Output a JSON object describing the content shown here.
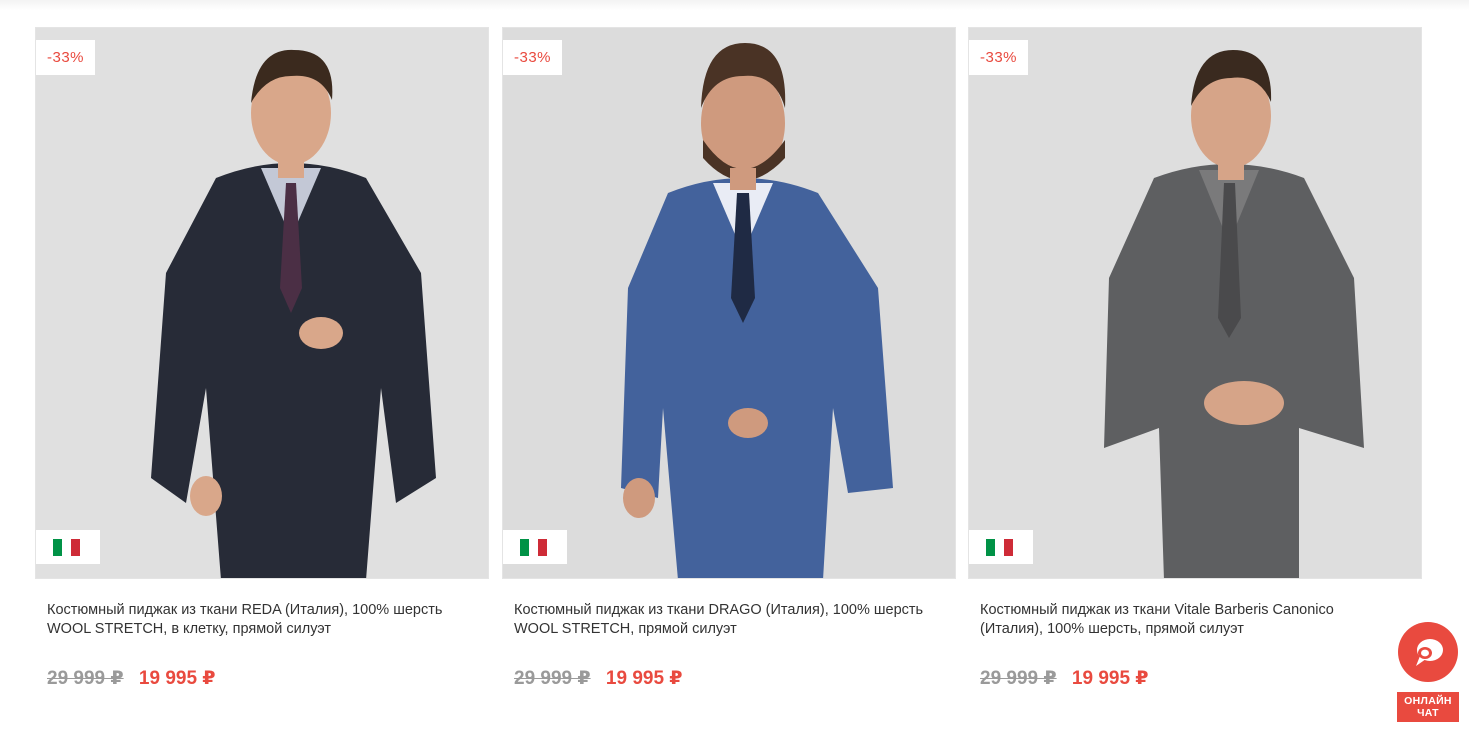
{
  "products": [
    {
      "discount_badge": "-33%",
      "flag_icon": "italy-flag-icon",
      "title": "Костюмный пиджак из ткани REDA (Италия), 100% шерсть WOOL STRETCH, в клетку, прямой силуэт",
      "old_price": "29 999 ₽",
      "new_price": "19 995 ₽",
      "jacket_color": "#272b37"
    },
    {
      "discount_badge": "-33%",
      "flag_icon": "italy-flag-icon",
      "title": "Костюмный пиджак из ткани DRAGO (Италия), 100% шерсть WOOL STRETCH, прямой силуэт",
      "old_price": "29 999 ₽",
      "new_price": "19 995 ₽",
      "jacket_color": "#43629c"
    },
    {
      "discount_badge": "-33%",
      "flag_icon": "italy-flag-icon",
      "title": "Костюмный пиджак из ткани Vitale Barberis Canonico (Италия), 100% шерсть, прямой силуэт",
      "old_price": "29 999 ₽",
      "new_price": "19 995 ₽",
      "jacket_color": "#5e5f61"
    }
  ],
  "chat": {
    "icon": "chat-bubble-icon",
    "label_line1": "ОНЛАЙН",
    "label_line2": "ЧАТ"
  },
  "colors": {
    "accent": "#e94a3f",
    "old_price": "#9a9a9a",
    "photo_background": "#e2e2e2",
    "flag_green": "#009246",
    "flag_white": "#ffffff",
    "flag_red": "#ce2b37"
  }
}
